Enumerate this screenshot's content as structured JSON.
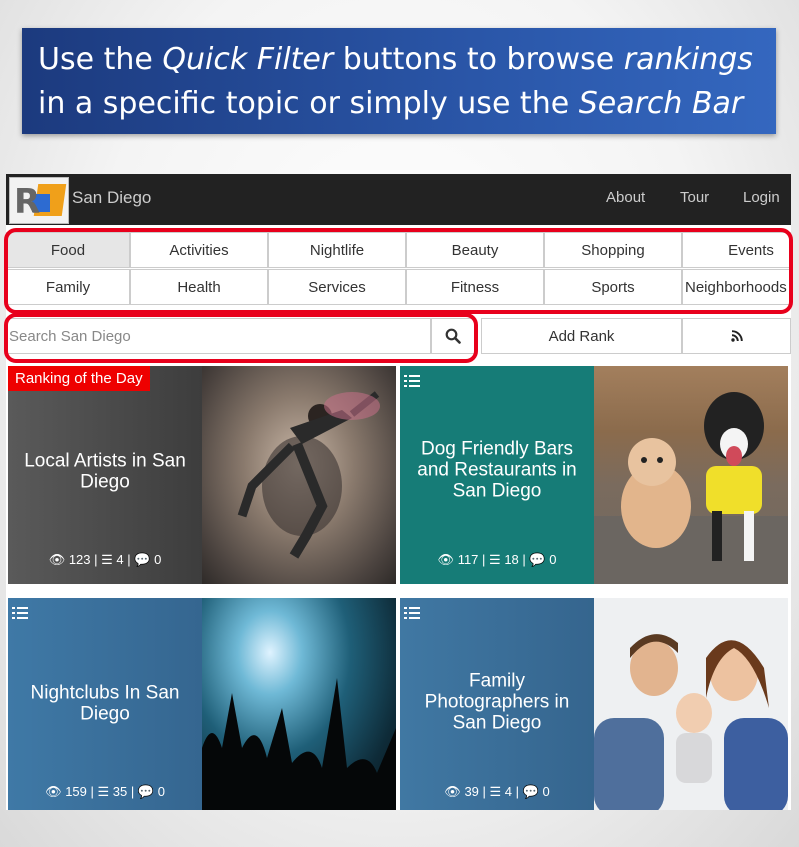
{
  "banner": {
    "line1_a": "Use the ",
    "line1_b": "Quick Filter",
    "line1_c": " buttons to browse ",
    "line1_d": "rankings",
    "line2_a": "in a specific topic or simply use the ",
    "line2_b": "Search Bar"
  },
  "navbar": {
    "brand": "San Diego",
    "links": [
      "About",
      "Tour",
      "Login"
    ]
  },
  "filters": {
    "row1": [
      "Food",
      "Activities",
      "Nightlife",
      "Beauty",
      "Shopping",
      "Events"
    ],
    "row2": [
      "Family",
      "Health",
      "Services",
      "Fitness",
      "Sports",
      "Neighborhoods"
    ],
    "active": "Food"
  },
  "search": {
    "placeholder": "Search San Diego",
    "add_rank": "Add Rank"
  },
  "cards": [
    {
      "title": "Local Artists in San Diego",
      "views": "123",
      "items": "4",
      "comments": "0",
      "badge": "Ranking of the Day",
      "color": "#4a4a4a"
    },
    {
      "title": "Dog Friendly Bars and Restaurants in San Diego",
      "views": "117",
      "items": "18",
      "comments": "0",
      "color": "#177e76"
    },
    {
      "title": "Nightclubs In San Diego",
      "views": "159",
      "items": "35",
      "comments": "0",
      "color": "#3a6f9b"
    },
    {
      "title": "Family Photographers in San Diego",
      "views": "39",
      "items": "4",
      "comments": "0",
      "color": "#3d6f97"
    }
  ],
  "colors": {
    "highlight": "#e8001c",
    "banner": "#2a56a8",
    "navbar": "#222222"
  },
  "icons": [
    "search-icon",
    "rss-icon",
    "list-icon",
    "eye-icon",
    "comment-icon"
  ]
}
